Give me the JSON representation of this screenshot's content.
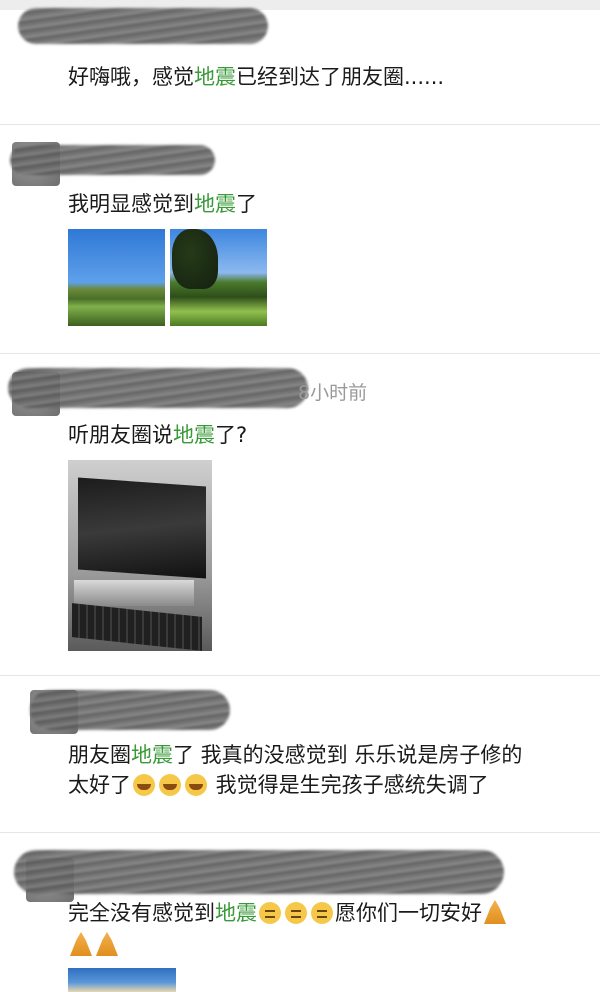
{
  "posts": [
    {
      "text_prefix": "好嗨哦，感觉",
      "keyword": "地震",
      "text_suffix": "已经到达了朋友圈......"
    },
    {
      "text_prefix": "我明显感觉到",
      "keyword": "地震",
      "text_suffix": "了",
      "images": [
        "field-photo",
        "tree-field-photo"
      ]
    },
    {
      "time": "8小时前",
      "text_prefix": "听朋友圈说",
      "keyword": "地震",
      "text_suffix": "了?",
      "images": [
        "computer-desk-photo"
      ]
    },
    {
      "line1_prefix": "朋友圈",
      "keyword": "地震",
      "line1_suffix": "了 我真的没感觉到 乐乐说是房子修的",
      "line2_prefix": "太好了",
      "line2_suffix": " 我觉得是生完孩子感统失调了",
      "emojis": [
        "sweat-smile",
        "sweat-smile",
        "sweat-smile"
      ]
    },
    {
      "text_prefix": "完全没有感觉到",
      "keyword": "地震",
      "text_suffix": "愿你们一切安好",
      "emojis": [
        "flushed",
        "flushed",
        "flushed"
      ],
      "prayers": [
        "pray",
        "pray",
        "pray"
      ]
    }
  ]
}
